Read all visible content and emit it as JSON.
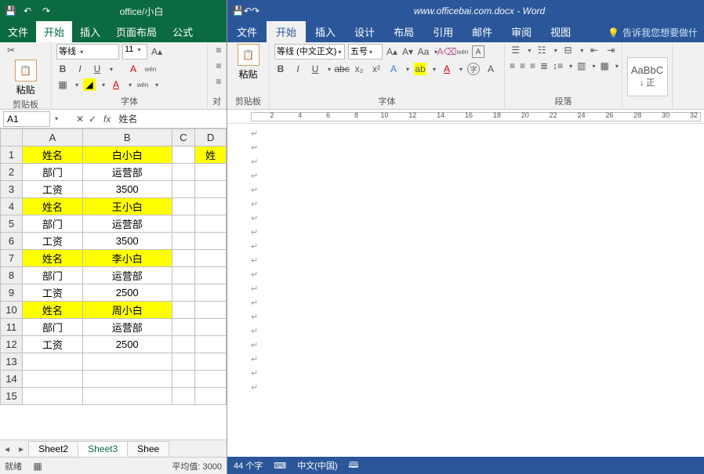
{
  "excel": {
    "title": "office/小白",
    "tabs": [
      "文件",
      "开始",
      "插入",
      "页面布局",
      "公式"
    ],
    "active_tab": "开始",
    "ribbon": {
      "paste_label": "粘贴",
      "clipboard_cap": "剪贴板",
      "font_name": "等线",
      "font_size": "11",
      "font_cap": "字体",
      "align_cap": "对"
    },
    "namebox": "A1",
    "formula": "姓名",
    "cols": [
      "A",
      "B",
      "C",
      "D"
    ],
    "rows": [
      {
        "n": 1,
        "a": "姓名",
        "b": "白小白",
        "d": "姓",
        "ylw": true
      },
      {
        "n": 2,
        "a": "部门",
        "b": "运营部"
      },
      {
        "n": 3,
        "a": "工资",
        "b": "3500"
      },
      {
        "n": 4,
        "a": "姓名",
        "b": "王小白",
        "ylw": true
      },
      {
        "n": 5,
        "a": "部门",
        "b": "运营部"
      },
      {
        "n": 6,
        "a": "工资",
        "b": "3500"
      },
      {
        "n": 7,
        "a": "姓名",
        "b": "李小白",
        "ylw": true
      },
      {
        "n": 8,
        "a": "部门",
        "b": "运营部"
      },
      {
        "n": 9,
        "a": "工资",
        "b": "2500"
      },
      {
        "n": 10,
        "a": "姓名",
        "b": "周小白",
        "ylw": true
      },
      {
        "n": 11,
        "a": "部门",
        "b": "运营部"
      },
      {
        "n": 12,
        "a": "工资",
        "b": "2500"
      },
      {
        "n": 13,
        "a": "",
        "b": ""
      },
      {
        "n": 14,
        "a": "",
        "b": ""
      },
      {
        "n": 15,
        "a": "",
        "b": ""
      }
    ],
    "sheets": [
      "Sheet2",
      "Sheet3",
      "Shee"
    ],
    "active_sheet": "Sheet3",
    "status": {
      "ready": "就绪",
      "avg_label": "平均值:",
      "avg_value": "3000"
    }
  },
  "word": {
    "title": "www.officebai.com.docx - Word",
    "tabs": [
      "文件",
      "开始",
      "插入",
      "设计",
      "布局",
      "引用",
      "邮件",
      "审阅",
      "视图"
    ],
    "active_tab": "开始",
    "tell_me": "告诉我您想要做什",
    "ribbon": {
      "paste_label": "粘贴",
      "clipboard_cap": "剪贴板",
      "font_name": "等线 (中文正文)",
      "font_size": "五号",
      "font_cap": "字体",
      "para_cap": "段落",
      "style_sample": "AaBbC",
      "style_name": "↓ 正"
    },
    "ruler_ticks": [
      "",
      "2",
      "",
      "4",
      "",
      "6",
      "",
      "8",
      "",
      "10",
      "",
      "12",
      "",
      "14",
      "",
      "16",
      "",
      "18",
      "",
      "20",
      "",
      "22",
      "",
      "24",
      "",
      "26",
      "",
      "28",
      "",
      "30",
      "",
      "32"
    ],
    "para_mark": "↵",
    "para_count": 19,
    "status": {
      "chars": "44 个字",
      "lang_icon": "⌨",
      "lang": "中文(中国)",
      "book": "🕮"
    }
  }
}
